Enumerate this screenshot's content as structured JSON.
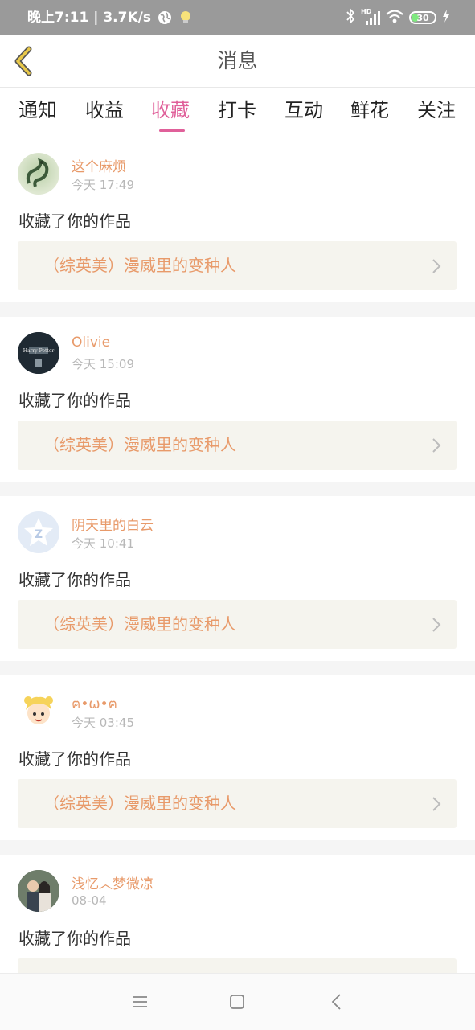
{
  "status_bar": {
    "time_speed": "晚上7:11 | 3.7K/s",
    "hd_label": "HD",
    "battery": "30"
  },
  "header": {
    "title": "消息"
  },
  "tabs": [
    {
      "label": "通知"
    },
    {
      "label": "收益"
    },
    {
      "label": "收藏",
      "active": true
    },
    {
      "label": "打卡"
    },
    {
      "label": "互动"
    },
    {
      "label": "鲜花"
    },
    {
      "label": "关注"
    }
  ],
  "feed": [
    {
      "user": "这个麻烦",
      "time": "今天 17:49",
      "action": "收藏了你的作品",
      "work": "（综英美）漫威里的变种人"
    },
    {
      "user": "Olivie",
      "time": "今天 15:09",
      "action": "收藏了你的作品",
      "work": "（综英美）漫威里的变种人"
    },
    {
      "user": "阴天里的白云",
      "time": "今天 10:41",
      "action": "收藏了你的作品",
      "work": "（综英美）漫威里的变种人"
    },
    {
      "user": "ฅ•ω•ฅ",
      "time": "今天 03:45",
      "action": "收藏了你的作品",
      "work": "（综英美）漫威里的变种人"
    },
    {
      "user": "浅忆︿梦微凉",
      "time": "08-04",
      "action": "收藏了你的作品",
      "work": ""
    }
  ],
  "colors": {
    "accent": "#e0609a",
    "username": "#e89a6a",
    "work_bg": "#f5f4ee",
    "back_arrow": "#e8c84a"
  }
}
